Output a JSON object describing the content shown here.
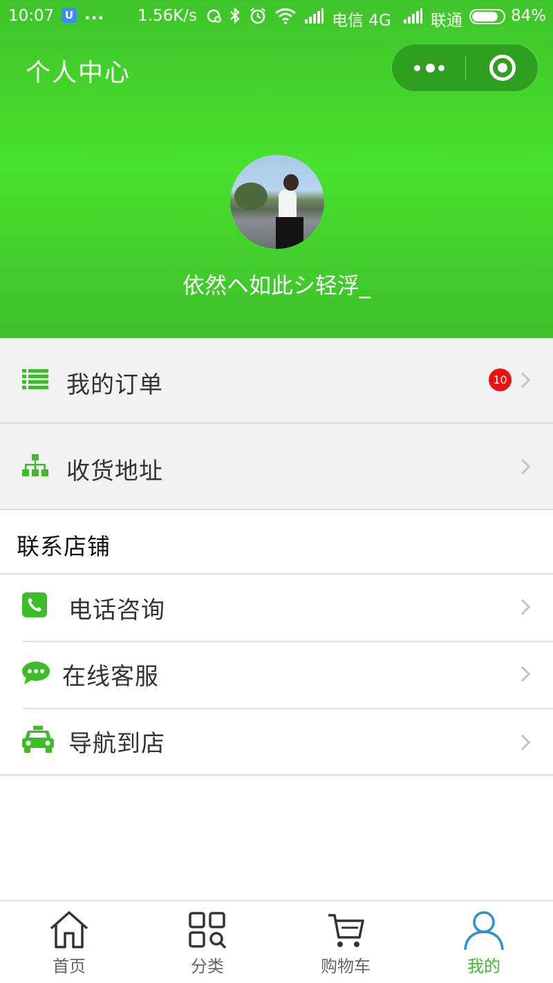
{
  "status_bar": {
    "time": "10:07",
    "app_badge": "U",
    "more": "...",
    "net_speed": "1.56K/s",
    "carrier1": "电信 4G",
    "carrier2": "联通",
    "battery": "84%",
    "battery_level": 0.84
  },
  "navbar": {
    "title": "个人中心"
  },
  "profile": {
    "username": "依然ヘ如此シ轻浮_"
  },
  "menu": {
    "orders_label": "我的订单",
    "orders_badge": "10",
    "address_label": "收货地址"
  },
  "contact": {
    "section_title": "联系店铺",
    "phone_label": "电话咨询",
    "chat_label": "在线客服",
    "navigate_label": "导航到店"
  },
  "tabbar": {
    "items": [
      {
        "label": "首页",
        "icon": "home-icon"
      },
      {
        "label": "分类",
        "icon": "category-icon"
      },
      {
        "label": "购物车",
        "icon": "cart-icon"
      },
      {
        "label": "我的",
        "icon": "user-icon"
      }
    ],
    "active_color": "#3cbc29",
    "active_icon_color": "#2a8fd6"
  },
  "colors": {
    "brand_green": "#49e02e",
    "icon_green": "#3cbc29",
    "badge_red": "#ee1111"
  }
}
